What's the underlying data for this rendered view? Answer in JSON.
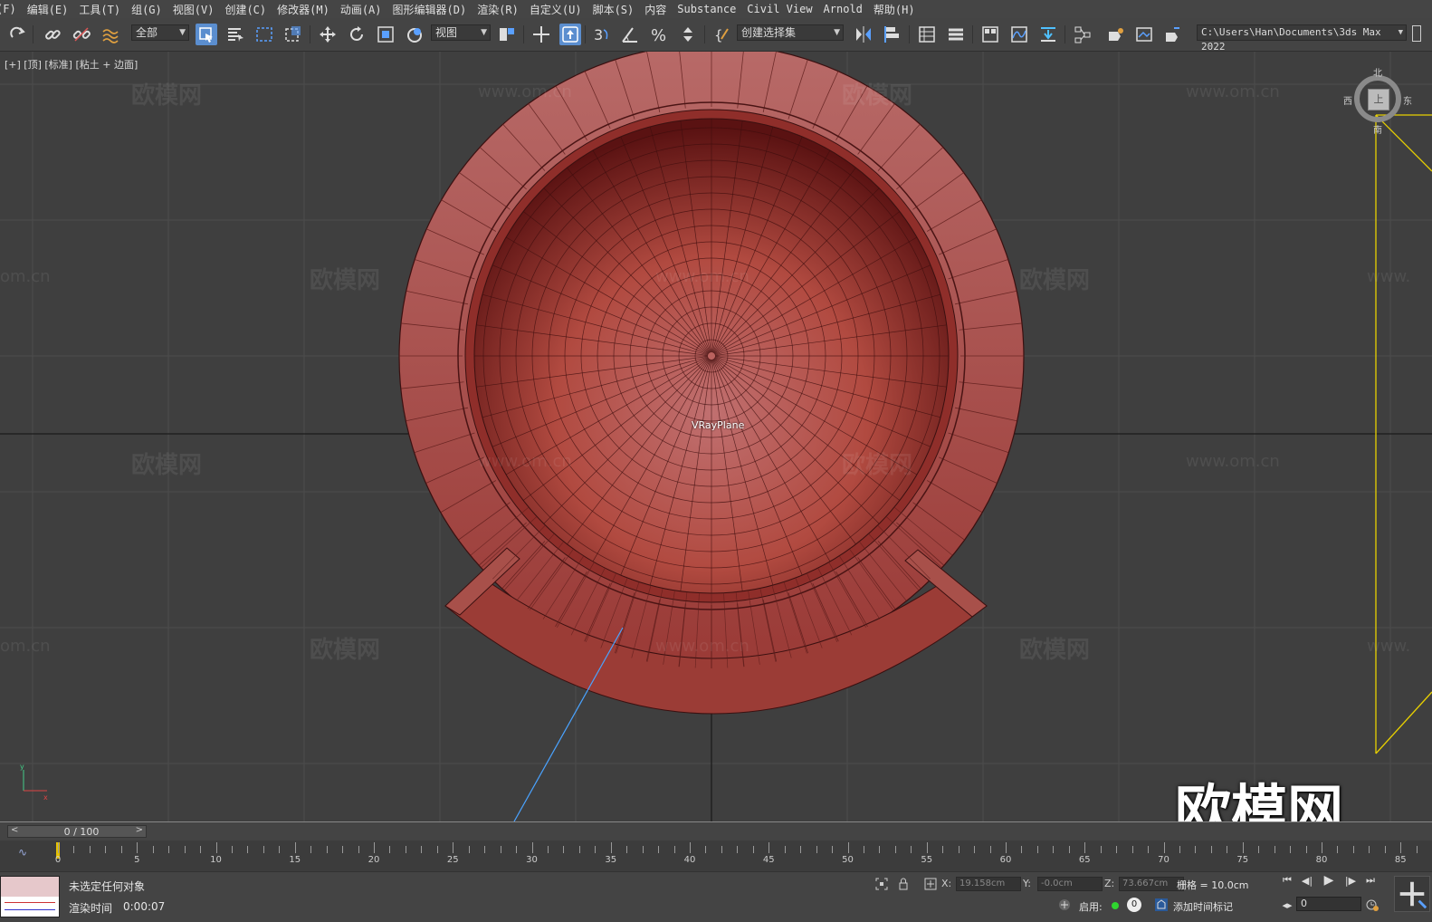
{
  "menubar": {
    "items": [
      "(F)",
      "编辑(E)",
      "工具(T)",
      "组(G)",
      "视图(V)",
      "创建(C)",
      "修改器(M)",
      "动画(A)",
      "图形编辑器(D)",
      "渲染(R)",
      "自定义(U)",
      "脚本(S)",
      "内容",
      "Substance",
      "Civil View",
      "Arnold",
      "帮助(H)"
    ]
  },
  "toolbar": {
    "filter_dropdown": "全部",
    "ref_coord_dropdown": "视图",
    "named_selection_dropdown": "创建选择集",
    "project_path": "C:\\Users\\Han\\Documents\\3ds Max 2022",
    "icons": [
      "redo-icon",
      "link-icon",
      "unlink-icon",
      "bind-space-warp-icon",
      "select-object-icon",
      "select-by-name-icon",
      "rect-selection-icon",
      "window-crossing-icon",
      "move-icon",
      "rotate-icon",
      "scale-icon",
      "placement-icon",
      "pivot-icon",
      "select-manipulate-icon",
      "snap-toggle-icon",
      "angle-snap-icon",
      "percent-snap-icon",
      "spinner-snap-icon",
      "edit-named-sets-icon",
      "mirror-icon",
      "align-icon",
      "scene-explorer-icon",
      "layer-explorer-icon",
      "ribbon-icon",
      "curve-editor-icon",
      "dope-sheet-icon",
      "schematic-view-icon",
      "render-setup-icon",
      "rendered-frame-icon",
      "render-icon"
    ]
  },
  "viewport": {
    "label": "[+] [顶] [标准] [粘土 + 边面]",
    "object_label": "VRayPlane",
    "viewcube": {
      "north": "北",
      "south": "南",
      "east": "东",
      "west": "西",
      "face": "上"
    },
    "watermark_cn": "欧模网",
    "watermark_url": "www.om.cn",
    "watermark_url_partial": "om.cn",
    "watermark_url_partial_right": "www.",
    "big_watermark": "欧模网",
    "model_color": "#a8433c"
  },
  "timeline": {
    "frame_display": "0 / 100",
    "ticks": [
      "0",
      "5",
      "10",
      "15",
      "20",
      "25",
      "30",
      "35",
      "40",
      "45",
      "50",
      "55",
      "60",
      "65",
      "70",
      "75",
      "80",
      "85"
    ],
    "current_frame": 0
  },
  "status": {
    "selection_text": "未选定任何对象",
    "render_time_label": "渲染时间",
    "render_time_value": "0:00:07",
    "x_label": "X:",
    "x_value": "19.158cm",
    "y_label": "Y:",
    "y_value": "-0.0cm",
    "z_label": "Z:",
    "z_value": "73.667cm",
    "grid_text": "栅格 = 10.0cm",
    "enable_label": "启用:",
    "enable_badge": "0",
    "add_time_tag": "添加时间标记",
    "frame_input": "0"
  }
}
